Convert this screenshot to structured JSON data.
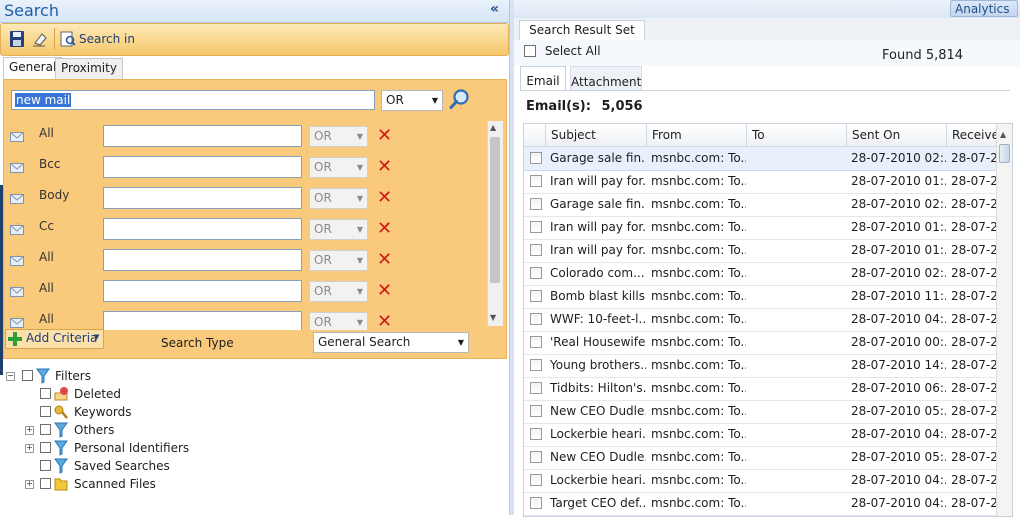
{
  "left": {
    "title": "Search",
    "collapse_glyph": "«",
    "toolbar": {
      "save_icon": "save-icon",
      "clear_icon": "eraser-icon",
      "search_in_label": "Search in"
    },
    "tabs": [
      "General",
      "Proximity"
    ],
    "query": {
      "value": "new mail",
      "operator": "OR"
    },
    "criteria": [
      {
        "field": "All",
        "operator": "OR"
      },
      {
        "field": "Bcc",
        "operator": "OR"
      },
      {
        "field": "Body",
        "operator": "OR"
      },
      {
        "field": "Cc",
        "operator": "OR"
      },
      {
        "field": "All",
        "operator": "OR"
      },
      {
        "field": "All",
        "operator": "OR"
      },
      {
        "field": "All",
        "operator": "OR"
      }
    ],
    "add_criteria_label": "Add Criteria",
    "search_type_label": "Search Type",
    "search_type_value": "General Search",
    "filters": {
      "root": "Filters",
      "items": [
        "Deleted",
        "Keywords",
        "Others",
        "Personal Identifiers",
        "Saved Searches",
        "Scanned Files"
      ]
    }
  },
  "right": {
    "analytics_label": "Analytics",
    "tab": "Search Result Set",
    "select_all": "Select All",
    "found": "Found 5,814",
    "inner_tabs": [
      "Email",
      "Attachment"
    ],
    "emails_label": "Email(s):",
    "emails_count": "5,056",
    "columns": [
      "Subject",
      "From",
      "To",
      "Sent On",
      "Receivec"
    ],
    "rows": [
      {
        "subject": "Garage sale fin...",
        "from": "msnbc.com: To...",
        "to": "",
        "sent": "28-07-2010 02:...",
        "received": "28-07-2"
      },
      {
        "subject": "Iran will pay for...",
        "from": "msnbc.com: To...",
        "to": "",
        "sent": "28-07-2010 01:...",
        "received": "28-07-2"
      },
      {
        "subject": "Garage sale fin...",
        "from": "msnbc.com: To...",
        "to": "",
        "sent": "28-07-2010 02:...",
        "received": "28-07-2"
      },
      {
        "subject": "Iran will pay for...",
        "from": "msnbc.com: To...",
        "to": "",
        "sent": "28-07-2010 01:...",
        "received": "28-07-2"
      },
      {
        "subject": "Iran will pay for...",
        "from": "msnbc.com: To...",
        "to": "",
        "sent": "28-07-2010 01:...",
        "received": "28-07-2"
      },
      {
        "subject": "Colorado com...",
        "from": "msnbc.com: To...",
        "to": "",
        "sent": "28-07-2010 02:...",
        "received": "28-07-2"
      },
      {
        "subject": "Bomb blast kills...",
        "from": "msnbc.com: To...",
        "to": "",
        "sent": "28-07-2010 11:...",
        "received": "28-07-2"
      },
      {
        "subject": "WWF: 10-feet-l...",
        "from": "msnbc.com: To...",
        "to": "",
        "sent": "28-07-2010 04:...",
        "received": "28-07-2"
      },
      {
        "subject": "'Real Housewife...",
        "from": "msnbc.com: To...",
        "to": "",
        "sent": "28-07-2010 00:...",
        "received": "28-07-2"
      },
      {
        "subject": "Young brothers...",
        "from": "msnbc.com: To...",
        "to": "",
        "sent": "28-07-2010 14:...",
        "received": "28-07-2"
      },
      {
        "subject": "Tidbits: Hilton's...",
        "from": "msnbc.com: To...",
        "to": "",
        "sent": "28-07-2010 06:...",
        "received": "28-07-2"
      },
      {
        "subject": "New CEO Dudle...",
        "from": "msnbc.com: To...",
        "to": "",
        "sent": "28-07-2010 05:...",
        "received": "28-07-2"
      },
      {
        "subject": "Lockerbie heari...",
        "from": "msnbc.com: To...",
        "to": "",
        "sent": "28-07-2010 04:...",
        "received": "28-07-2"
      },
      {
        "subject": "New CEO Dudle...",
        "from": "msnbc.com: To...",
        "to": "",
        "sent": "28-07-2010 05:...",
        "received": "28-07-2"
      },
      {
        "subject": "Lockerbie heari...",
        "from": "msnbc.com: To...",
        "to": "",
        "sent": "28-07-2010 04:...",
        "received": "28-07-2"
      },
      {
        "subject": "Target CEO def...",
        "from": "msnbc.com: To...",
        "to": "",
        "sent": "28-07-2010 04:...",
        "received": "28-07-2"
      }
    ]
  },
  "colors": {
    "panel": "#f9c97c",
    "toolbar": "#f6c86a",
    "title": "#1f5fa8",
    "remove_x": "#d11b1b"
  }
}
